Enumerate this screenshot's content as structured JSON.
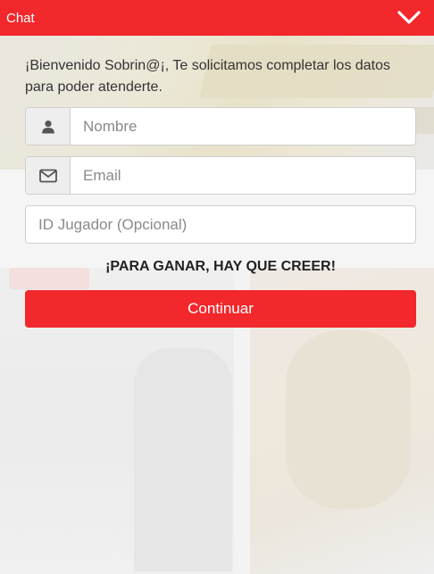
{
  "header": {
    "title": "Chat",
    "collapse_icon": "chevron-down-icon",
    "color": "#f2282c"
  },
  "form": {
    "welcome_text": "¡Bienvenido Sobrin@¡, Te solicitamos completar los datos para poder atenderte.",
    "name_field": {
      "icon": "user-icon",
      "value": "",
      "placeholder": "Nombre"
    },
    "email_field": {
      "icon": "envelope-icon",
      "value": "",
      "placeholder": "Email"
    },
    "player_id_field": {
      "value": "",
      "placeholder": "ID Jugador (Opcional)"
    },
    "slogan": "¡PARA GANAR, HAY QUE CREER!",
    "submit_label": "Continuar"
  }
}
